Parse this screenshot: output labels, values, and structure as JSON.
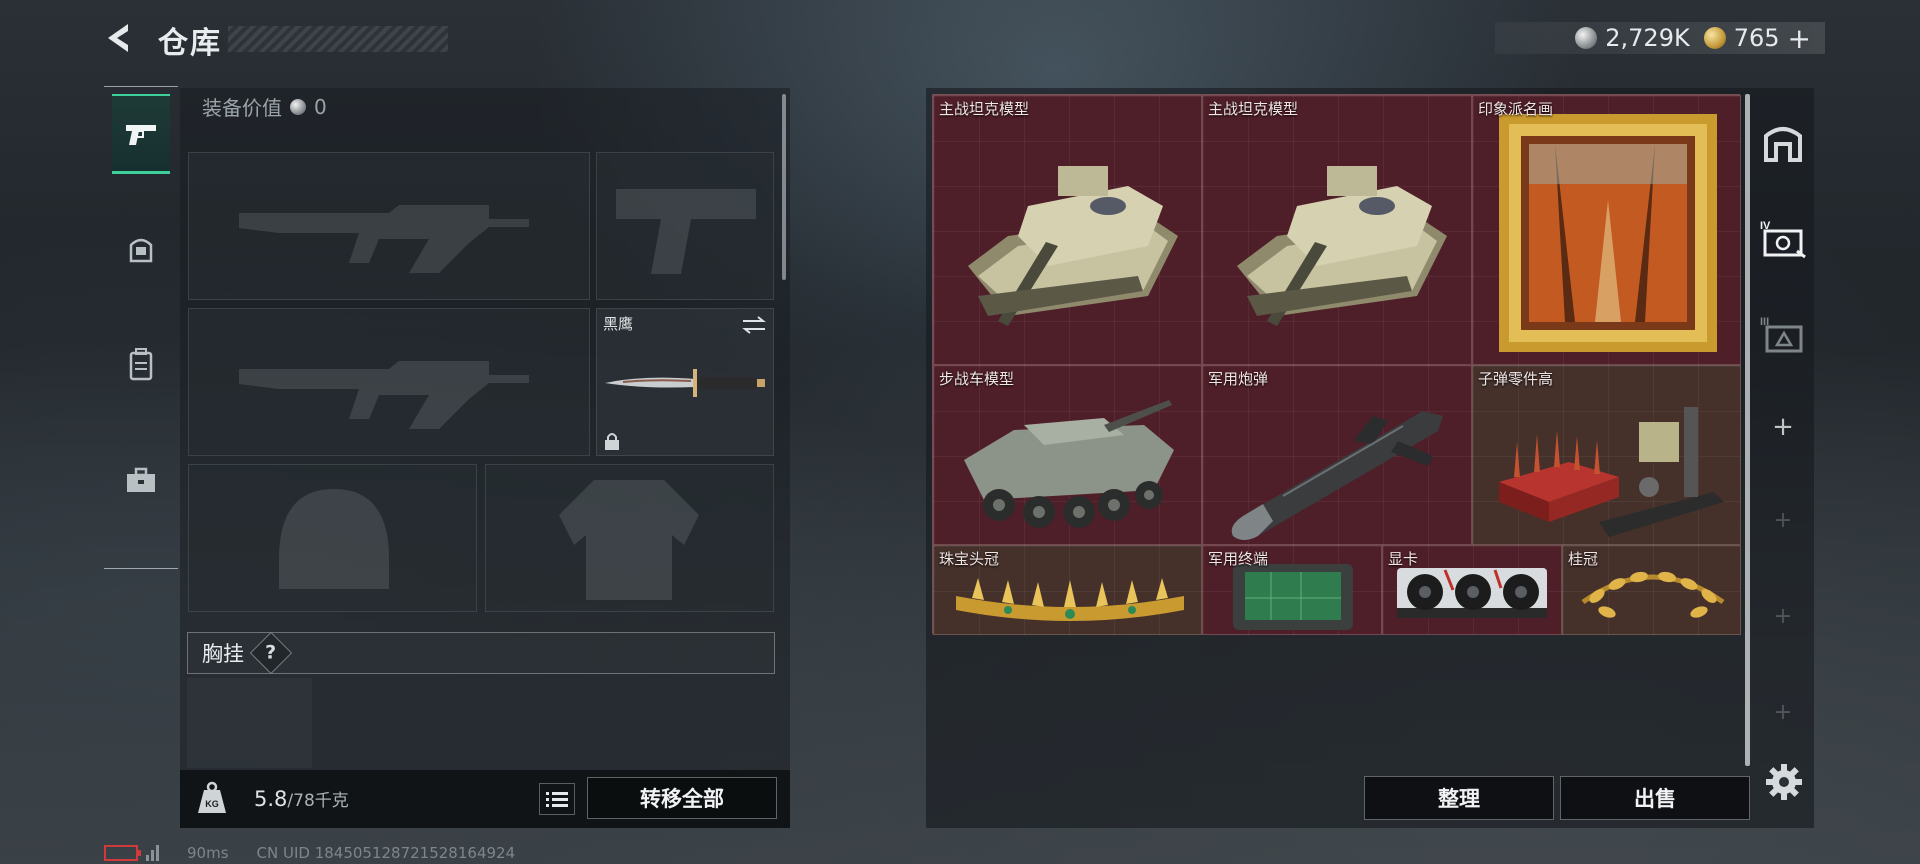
{
  "header": {
    "title": "仓库",
    "currency_silver": "2,729K",
    "currency_gold": "765",
    "plus_label": "+"
  },
  "left_tabs": [
    {
      "icon": "pistol-icon",
      "active": true
    },
    {
      "icon": "helmet-icon",
      "active": false
    },
    {
      "icon": "backpack-icon",
      "active": false
    },
    {
      "icon": "toolbox-icon",
      "active": false
    }
  ],
  "equipment": {
    "value_label": "装备价值",
    "value": "0",
    "melee_slot_label": "黑鹰",
    "chest_rig_label": "胸挂",
    "chest_rig_help": "?"
  },
  "bottom_bar": {
    "weight_current": "5.8",
    "weight_max": "/78千克",
    "weight_icon_text": "KG",
    "transfer_all_label": "转移全部"
  },
  "status": {
    "ping": "90ms",
    "uid": "CN UID 1845051287215281649​24"
  },
  "stash_items": [
    {
      "name": "主战坦克模型"
    },
    {
      "name": "主战坦克模型"
    },
    {
      "name": "印象派名画"
    },
    {
      "name": "步战车模型"
    },
    {
      "name": "军用炮弹"
    },
    {
      "name": "子弹零件高"
    },
    {
      "name": "珠宝头冠"
    },
    {
      "name": "军用终端"
    },
    {
      "name": "显卡"
    },
    {
      "name": "桂冠"
    }
  ],
  "right_tabs": {
    "plus_label": "+"
  },
  "actions": {
    "sort_label": "整理",
    "sell_label": "出售"
  },
  "colors": {
    "accent_green": "#3ecf9a",
    "stash_bg": "#4e1e28",
    "battery_red": "#d03a3a"
  }
}
